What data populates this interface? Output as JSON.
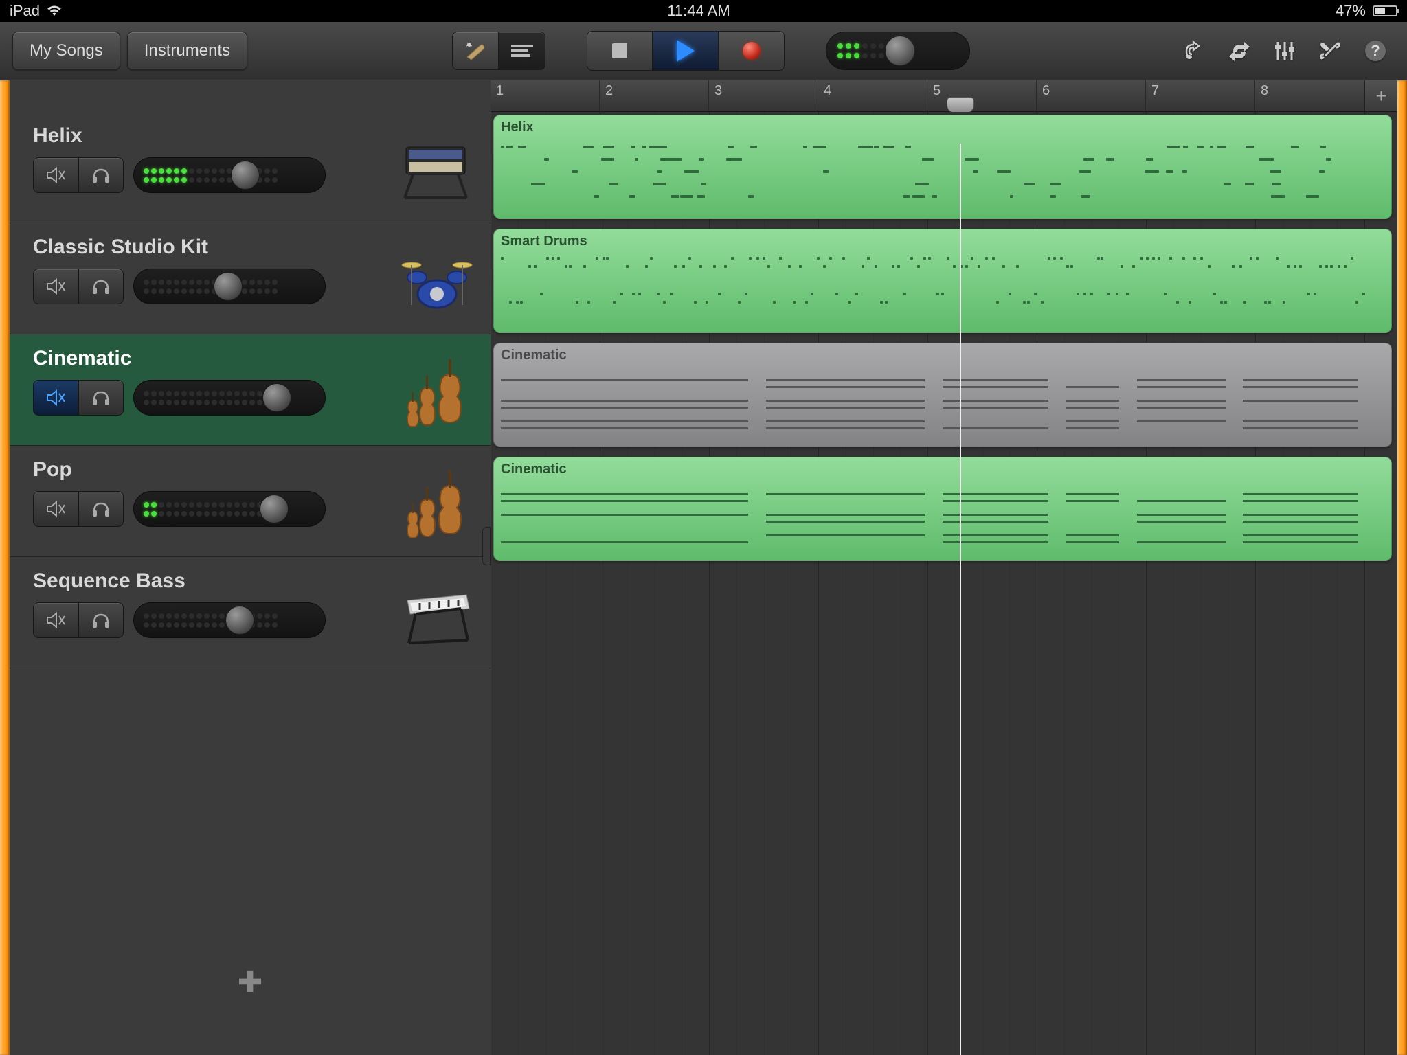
{
  "status_bar": {
    "carrier": "iPad",
    "time": "11:44 AM",
    "battery_pct": "47%"
  },
  "toolbar": {
    "my_songs": "My Songs",
    "instruments": "Instruments"
  },
  "ruler": {
    "bars": [
      "1",
      "2",
      "3",
      "4",
      "5",
      "6",
      "7",
      "8"
    ],
    "playhead_bar": 5.3
  },
  "tracks": [
    {
      "name": "Helix",
      "region_label": "Helix",
      "instrument": "synth",
      "muted": false,
      "selected": false,
      "volume": 0.62,
      "leds": 6,
      "region_color": "green"
    },
    {
      "name": "Classic Studio Kit",
      "region_label": "Smart Drums",
      "instrument": "drums",
      "muted": false,
      "selected": false,
      "volume": 0.5,
      "leds": 0,
      "region_color": "green"
    },
    {
      "name": "Cinematic",
      "region_label": "Cinematic",
      "instrument": "strings",
      "muted": true,
      "selected": true,
      "volume": 0.84,
      "leds": 0,
      "region_color": "gray"
    },
    {
      "name": "Pop",
      "region_label": "Cinematic",
      "instrument": "strings",
      "muted": false,
      "selected": false,
      "volume": 0.82,
      "leds": 2,
      "region_color": "green"
    },
    {
      "name": "Sequence Bass",
      "region_label": "",
      "instrument": "keys",
      "muted": false,
      "selected": false,
      "volume": 0.58,
      "leds": 0,
      "region_color": "none"
    }
  ]
}
